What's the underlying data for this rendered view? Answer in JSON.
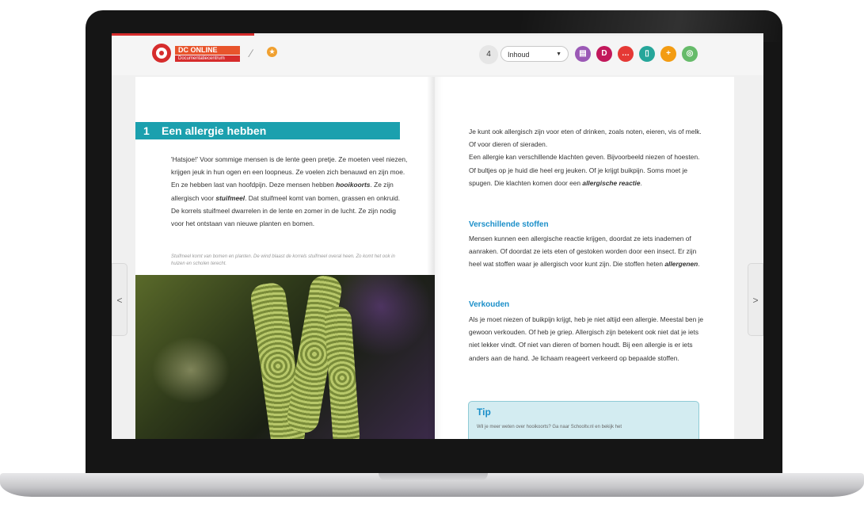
{
  "app": {
    "logo_title": "DC ONLINE",
    "logo_subtitle": "Documentatiecentrum"
  },
  "toolbar": {
    "page_number": "4",
    "chapter_select_value": "Inhoud",
    "buttons": [
      {
        "name": "book-button",
        "glyph": "▤",
        "color": "#9b59b6"
      },
      {
        "name": "d-button",
        "glyph": "D",
        "color": "#c2185b"
      },
      {
        "name": "comment-button",
        "glyph": "…",
        "color": "#e53935"
      },
      {
        "name": "note-button",
        "glyph": "▯",
        "color": "#26a69a"
      },
      {
        "name": "add-button",
        "glyph": "+",
        "color": "#f39c12"
      },
      {
        "name": "globe-button",
        "glyph": "◎",
        "color": "#66bb6a"
      }
    ]
  },
  "left_page": {
    "chapter_number": "1",
    "chapter_title": "Een allergie hebben",
    "p1_a": "'Hatsjoe!' Voor sommige mensen is de lente geen pretje. Ze moeten veel niezen, krijgen jeuk in hun ogen en een loopneus. Ze voelen zich benauwd en zijn moe. En ze hebben last van hoofdpijn. Deze mensen hebben ",
    "p1_b": "hooikoorts",
    "p1_c": ". Ze zijn allergisch voor ",
    "p1_d": "stuifmeel",
    "p1_e": ". Dat stuifmeel komt van bomen, grassen en onkruid. De korrels stuifmeel dwarrelen in de lente en zomer in de lucht. Ze zijn nodig voor het ontstaan van nieuwe planten en bomen.",
    "caption": "Stuifmeel komt van bomen en planten. De wind blaast de korrels stuifmeel overal heen. Zo komt het ook in huizen en scholen terecht."
  },
  "right_page": {
    "p1_a": "Je kunt ook allergisch zijn voor eten of drinken, zoals noten, eieren, vis of melk. Of voor dieren of sieraden.",
    "p1_b": "Een allergie kan verschillende klachten geven. Bijvoorbeeld niezen of hoesten. Of bultjes op je huid die heel erg jeuken. Of je krijgt buikpijn. Soms moet je spugen. Die klachten komen door een ",
    "p1_c": "allergische reactie",
    "p1_d": ".",
    "h1": "Verschillende stoffen",
    "p2_a": "Mensen kunnen een allergische reactie krijgen, doordat ze iets inademen of aanraken. Of doordat ze iets eten of gestoken worden door een insect. Er zijn heel wat stoffen waar je allergisch voor kunt zijn. Die stoffen heten ",
    "p2_b": "allergenen",
    "p2_c": ".",
    "h2": "Verkouden",
    "p3": "Als je moet niezen of buikpijn krijgt, heb je niet altijd een allergie. Meestal ben je gewoon verkouden. Of heb je griep. Allergisch zijn betekent ook niet dat je iets niet lekker vindt. Of niet van dieren of bomen houdt. Bij een allergie is er iets anders aan de hand. Je lichaam reageert verkeerd op bepaalde stoffen.",
    "tip_label": "Tip",
    "tip_text": "Wil je meer weten over hooikoorts? Ga naar Schooltv.nl en bekijk het"
  },
  "navigation": {
    "prev": "<",
    "next": ">"
  }
}
